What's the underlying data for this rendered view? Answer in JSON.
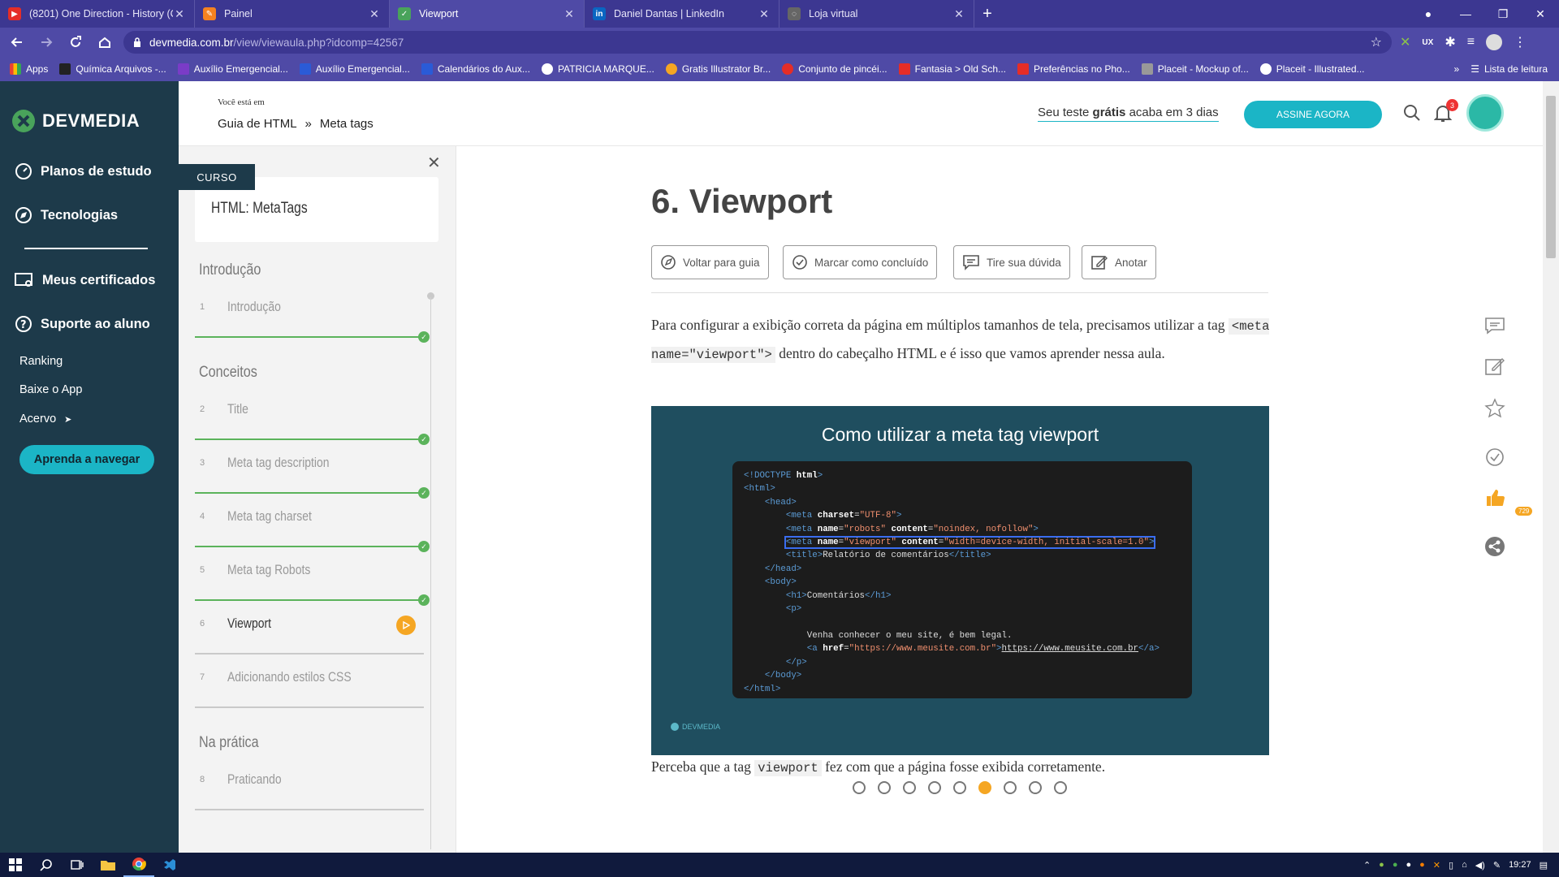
{
  "browser": {
    "tabs": [
      {
        "title": "(8201) One Direction - History (C",
        "fav_color": "#e52d27",
        "fav_glyph": "▶"
      },
      {
        "title": "Painel",
        "fav_color": "#f58220",
        "fav_glyph": "✎"
      },
      {
        "title": "Viewport",
        "fav_color": "#49a35b",
        "fav_glyph": "✓"
      },
      {
        "title": "Daniel Dantas | LinkedIn",
        "fav_color": "#0a66c2",
        "fav_glyph": "in"
      },
      {
        "title": "Loja virtual",
        "fav_color": "#666666",
        "fav_glyph": "◌"
      }
    ],
    "url_host": "devmedia.com.br",
    "url_path": "/view/viewaula.php?idcomp=42567",
    "bookmarks": [
      {
        "label": "Apps",
        "color": "#e94235"
      },
      {
        "label": "Química Arquivos -...",
        "color": "#222222"
      },
      {
        "label": "Auxílio Emergencial...",
        "color": "#7a3cc7"
      },
      {
        "label": "Auxílio Emergencial...",
        "color": "#2a5bd7"
      },
      {
        "label": "Calendários do Aux...",
        "color": "#2a5bd7"
      },
      {
        "label": "PATRICIA MARQUE...",
        "color": "#ffffff"
      },
      {
        "label": "Gratis Illustrator Br...",
        "color": "#f5a623"
      },
      {
        "label": "Conjunto de pincéi...",
        "color": "#e52d27"
      },
      {
        "label": "Fantasia > Old Sch...",
        "color": "#e52d27"
      },
      {
        "label": "Preferências no Pho...",
        "color": "#e52d27"
      },
      {
        "label": "Placeit - Mockup of...",
        "color": "#999999"
      },
      {
        "label": "Placeit - Illustrated...",
        "color": "#ffffff"
      }
    ],
    "overflow_chevron": "»",
    "reading_list": "Lista de leitura"
  },
  "sidebar": {
    "logo": "DEVMEDIA",
    "items": [
      {
        "label": "Planos de estudo",
        "icon": "speedometer-icon"
      },
      {
        "label": "Tecnologias",
        "icon": "compass-icon"
      },
      {
        "label": "Meus certificados",
        "icon": "certificate-icon"
      },
      {
        "label": "Suporte ao aluno",
        "icon": "help-icon"
      }
    ],
    "links": [
      "Ranking",
      "Baixe o App",
      "Acervo"
    ],
    "acervo_arrow": "➤",
    "cta": "Aprenda a navegar"
  },
  "header": {
    "breadcrumb_prefix": "Você está em",
    "breadcrumb": [
      "Guia de HTML",
      "»",
      "Meta tags"
    ],
    "trial_pre": "Seu teste ",
    "trial_bold": "grátis",
    "trial_post": " acaba em 3 dias",
    "cta": "ASSINE AGORA",
    "notifications": "3"
  },
  "course": {
    "tag": "CURSO",
    "title": "HTML: MetaTags",
    "sections": [
      {
        "title": "Introdução",
        "lessons": [
          {
            "num": "1",
            "label": "Introdução",
            "done": true
          }
        ]
      },
      {
        "title": "Conceitos",
        "lessons": [
          {
            "num": "2",
            "label": "Title",
            "done": true
          },
          {
            "num": "3",
            "label": "Meta tag description",
            "done": true
          },
          {
            "num": "4",
            "label": "Meta tag charset",
            "done": true
          },
          {
            "num": "5",
            "label": "Meta tag Robots",
            "done": true
          },
          {
            "num": "6",
            "label": "Viewport",
            "done": false,
            "current": true
          },
          {
            "num": "7",
            "label": "Adicionando estilos CSS",
            "done": false
          }
        ]
      },
      {
        "title": "Na prática",
        "lessons": [
          {
            "num": "8",
            "label": "Praticando",
            "done": false
          }
        ]
      }
    ]
  },
  "lesson": {
    "title": "6. Viewport",
    "actions": [
      {
        "label": "Voltar para guia",
        "icon": "compass-icon"
      },
      {
        "label": "Marcar como concluído",
        "icon": "check-circle-icon"
      },
      {
        "label": "Tire sua dúvida",
        "icon": "comment-icon"
      },
      {
        "label": "Anotar",
        "icon": "edit-icon"
      }
    ],
    "intro_pre": "Para configurar a exibição correta da página em múltiplos tamanhos de tela, precisamos utilizar a tag ",
    "intro_code": "<meta name=\"viewport\">",
    "intro_post": " dentro do cabeçalho HTML e é isso que vamos aprender nessa aula.",
    "slide_title": "Como utilizar a meta tag viewport",
    "slide_brand": "DEVMEDIA",
    "code": {
      "doctype": "<!DOCTYPE ",
      "doctype_attr": "html",
      "meta": "meta",
      "charset_attr": "charset",
      "charset_val": "\"UTF-8\"",
      "name_attr": "name",
      "robots_val": "\"robots\"",
      "content_attr": "content",
      "robots_content": "\"noindex, nofollow\"",
      "viewport_val": "\"viewport\"",
      "viewport_content": "\"width=device-width, initial-scale=1.0\"",
      "title_text": "Relatório de comentários",
      "h1_text": "Comentários",
      "p_text": "Venha conhecer o meu site, é bem legal.",
      "href_attr": "href",
      "href_val": "\"https://www.meusite.com.br\"",
      "link_text": "https://www.meusite.com.br"
    },
    "pagination": {
      "total": 9,
      "current": 6
    },
    "after_pre": "Perceba que a tag ",
    "after_code": "viewport",
    "after_post": " fez com que a página fosse exibida corretamente."
  },
  "rail": {
    "likes": "729"
  },
  "taskbar": {
    "time": "19:27"
  }
}
